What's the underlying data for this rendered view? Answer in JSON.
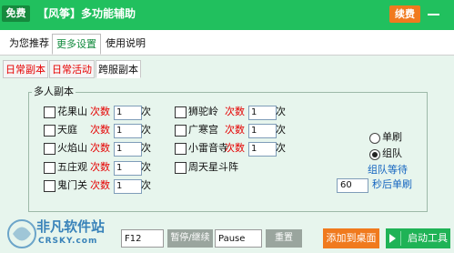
{
  "titlebar": {
    "free_badge": "免费",
    "title": "【风筝】多功能辅助",
    "renew_button": "续费"
  },
  "main_tabs": [
    {
      "label": "为您推荐",
      "active": false
    },
    {
      "label": "更多设置",
      "active": true
    },
    {
      "label": "使用说明",
      "active": false
    }
  ],
  "sub_tabs": [
    {
      "label": "日常副本",
      "active": false
    },
    {
      "label": "日常活动",
      "active": false
    },
    {
      "label": "跨服副本",
      "active": true
    }
  ],
  "group": {
    "title": "多人副本",
    "count_label": "次数",
    "unit": "次",
    "left_column": [
      {
        "name": "花果山",
        "count": "1"
      },
      {
        "name": "天庭",
        "count": "1"
      },
      {
        "name": "火焰山",
        "count": "1"
      },
      {
        "name": "五庄观",
        "count": "1"
      },
      {
        "name": "鬼门关",
        "count": "1"
      }
    ],
    "right_column": [
      {
        "name": "狮驼岭",
        "count": "1"
      },
      {
        "name": "广寒宫",
        "count": "1"
      },
      {
        "name": "小雷音寺",
        "count": "1"
      },
      {
        "name": "周天星斗阵",
        "count": null
      }
    ],
    "mode": {
      "single_label": "单刷",
      "team_label": "组队",
      "selected": "组队"
    },
    "team_wait_label": "组队等待",
    "wait_value": "60",
    "wait_suffix": "秒后单刷"
  },
  "bottombar": {
    "hotkey_value": "F12",
    "pause_button": "暂停/继续",
    "pause_value": "Pause",
    "reset_button": "重置",
    "add_desktop_button": "添加到桌面",
    "start_button": "启动工具"
  },
  "watermark": {
    "name": "非凡软件站",
    "url": "CRSKY.com"
  },
  "colors": {
    "titlebar": "#21c05e",
    "accent_orange": "#f07a1e",
    "content_bg": "#e7f5ed",
    "count_red": "#e60000",
    "link_blue": "#1565c0"
  }
}
